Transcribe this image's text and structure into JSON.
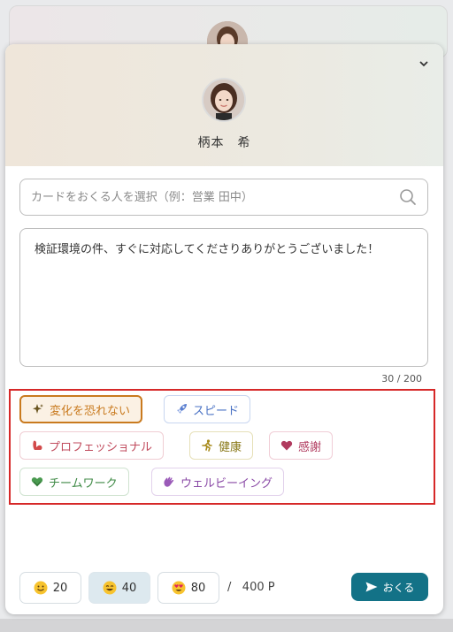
{
  "recipient": {
    "name": "柄本　希"
  },
  "search": {
    "placeholder": "カードをおくる人を選択（例：営業 田中）"
  },
  "message": {
    "text": "検証環境の件、すぐに対応してくださりありがとうございました！",
    "counter": "30 / 200"
  },
  "tags": [
    {
      "label": "変化を恐れない",
      "icon": "sparkle-icon",
      "color": "#c97a1e",
      "selected": true
    },
    {
      "label": "スピード",
      "icon": "rocket-icon",
      "color": "#4a72c4",
      "selected": false
    },
    {
      "label": "プロフェッショナル",
      "icon": "muscle-icon",
      "color": "#c04a5c",
      "selected": false
    },
    {
      "label": "健康",
      "icon": "runner-icon",
      "color": "#8a7a1a",
      "selected": false
    },
    {
      "label": "感謝",
      "icon": "heart-icon",
      "color": "#b03a5e",
      "selected": false
    },
    {
      "label": "チームワーク",
      "icon": "heart-hands-icon",
      "color": "#3f8a46",
      "selected": false
    },
    {
      "label": "ウェルビーイング",
      "icon": "wave-hand-icon",
      "color": "#8a4aa6",
      "selected": false
    }
  ],
  "points": {
    "options": [
      {
        "value": "20",
        "icon": "smile-emoji-icon",
        "selected": false
      },
      {
        "value": "40",
        "icon": "grin-emoji-icon",
        "selected": true
      },
      {
        "value": "80",
        "icon": "heart-eyes-emoji-icon",
        "selected": false
      }
    ],
    "separator": "/",
    "total": "400 P"
  },
  "send_button": {
    "label": "おくる",
    "color": "#137287"
  }
}
